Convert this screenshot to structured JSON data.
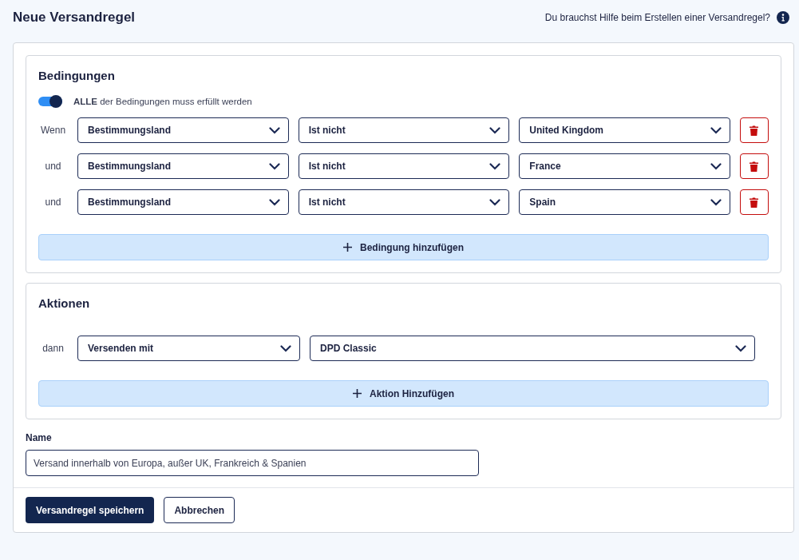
{
  "title": "Neue Versandregel",
  "help_link": "Du brauchst Hilfe beim Erstellen einer Versandregel?",
  "conditions": {
    "heading": "Bedingungen",
    "toggle": {
      "on": true,
      "label": "**ALLE** der Bedingungen muss erfüllt werden"
    },
    "rows": [
      {
        "connector": "Wenn",
        "field": "Bestimmungsland",
        "operator": "Ist nicht",
        "value": "United Kingdom"
      },
      {
        "connector": "und",
        "field": "Bestimmungsland",
        "operator": "Ist nicht",
        "value": "France"
      },
      {
        "connector": "und",
        "field": "Bestimmungsland",
        "operator": "Ist nicht",
        "value": "Spain"
      }
    ],
    "add_button": "Bedingung hinzufügen"
  },
  "actions": {
    "heading": "Aktionen",
    "rows": [
      {
        "connector": "dann",
        "action": "Versenden mit",
        "value": "DPD Classic"
      }
    ],
    "add_button": "Aktion Hinzufügen"
  },
  "name": {
    "label": "Name",
    "value": "Versand innerhalb von Europa, außer UK, Frankreich & Spanien"
  },
  "buttons": {
    "save": "Versandregel speichern",
    "cancel": "Abbrechen"
  }
}
